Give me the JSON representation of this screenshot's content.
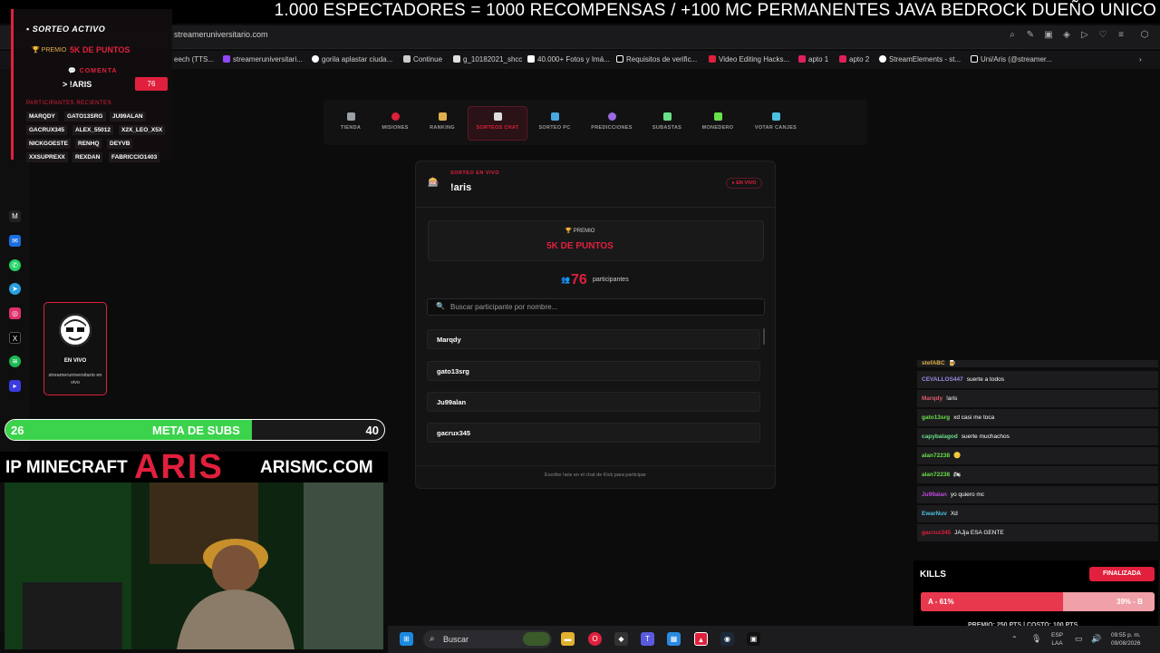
{
  "banner": {
    "text": "1.000 ESPECTADORES = 1000 RECOMPENSAS / +100 MC PERMANENTES JAVA BEDROCK DUEÑO UNICO"
  },
  "browser": {
    "url": "streameruniversitario.com",
    "bookmarks": [
      "eech (TTS...",
      "streameruniversitari...",
      "gorila aplastar ciuda...",
      "Continue",
      "g_10182021_shcc",
      "40.000+ Fotos y Imá...",
      "Requisitos de verific...",
      "Video Editing Hacks...",
      "apto 1",
      "apto 2",
      "StreamElements - st...",
      "Uni/Aris (@streamer..."
    ]
  },
  "raffle_overlay": {
    "title": "SORTEO ACTIVO",
    "prize_label": "PREMIO",
    "prize_value": "5K DE PUNTOS",
    "comment_label": "COMENTA",
    "command": "> !ARIS",
    "count": "76",
    "participants_label": "PARTICIPANTES RECIENTES",
    "participants": [
      "MARQDY",
      "GATO13SRG",
      "JU99ALAN",
      "GACRUX345",
      "ALEX_55012",
      "X2X_LEO_X5X",
      "NICKGOESTE",
      "RENHQ",
      "DEYVB",
      "XXSUPREXX",
      "REXDAN",
      "FABRICCIO1403"
    ]
  },
  "streamer_card": {
    "live": "EN VIVO",
    "name": "streameruniversitario en vivo"
  },
  "subs_goal": {
    "current": "26",
    "label": "META DE SUBS",
    "target": "40",
    "progress": 0.65
  },
  "ip_banner": {
    "left": "IP MINECRAFT",
    "brand": "ARIS",
    "right": "ARISMC.COM"
  },
  "nav": {
    "items": [
      {
        "label": "TIENDA",
        "color": "#9aa0a6"
      },
      {
        "label": "MISIONES",
        "color": "#e0203c"
      },
      {
        "label": "RANKING",
        "color": "#e0b04a"
      },
      {
        "label": "SORTEOS CHAT",
        "color": "#ddd"
      },
      {
        "label": "SORTEO PC",
        "color": "#4aa8e0"
      },
      {
        "label": "PREDICCIONES",
        "color": "#9a6ae0"
      },
      {
        "label": "SUBASTAS",
        "color": "#6ae08a"
      },
      {
        "label": "MONEDERO",
        "color": "#6ae04a"
      },
      {
        "label": "VOTAR CANJES",
        "color": "#4ac0e0"
      }
    ]
  },
  "panel": {
    "subtitle": "SORTEO EN VIVO",
    "title": "!aris",
    "live": "● EN VIVO",
    "prize_label": "🏆 PREMIO",
    "prize_value": "5K DE PUNTOS",
    "count": "76",
    "count_label": "participantes",
    "search_placeholder": "Buscar participante por nombre...",
    "participants": [
      "Marqdy",
      "gato13srg",
      "Ju99alan",
      "gacrux345"
    ],
    "footer": "Escribe !aris en el chat de Kick para participar"
  },
  "chat": [
    {
      "user": "stefABC",
      "color": "#e0b04a",
      "msg": "🍺"
    },
    {
      "user": "CEVALLOS447",
      "color": "#9a8ae0",
      "msg": "suerte a todos"
    },
    {
      "user": "Marqdy",
      "color": "#e05a6a",
      "msg": "!aris"
    },
    {
      "user": "gato13srg",
      "color": "#6ae04a",
      "msg": "xd casi me toca"
    },
    {
      "user": "capybalagod",
      "color": "#6ae08a",
      "msg": "suerte muchachos"
    },
    {
      "user": "alan72238",
      "color": "#6ae04a",
      "msg": "🪙"
    },
    {
      "user": "alan72238",
      "color": "#6ae04a",
      "msg": "🏍"
    },
    {
      "user": "Ju99alan",
      "color": "#c04ae0",
      "msg": "yo quiero mc"
    },
    {
      "user": "EwarNuv",
      "color": "#4ac0e0",
      "msg": "Xd"
    },
    {
      "user": "gacrux345",
      "color": "#e0203c",
      "msg": "JAJja ESA GENTE"
    }
  ],
  "kills": {
    "title": "KILLS",
    "status": "FINALIZADA",
    "a_label": "A - 61%",
    "b_label": "39% - B",
    "a_pct": 0.61,
    "prize_line": "PREMIO: 250 PTS | COSTO: 100 PTS"
  },
  "taskbar": {
    "search": "Buscar",
    "lang": "ESP",
    "layout": "LAA",
    "time": "09:55 p. m.",
    "date": "09/08/2026"
  }
}
